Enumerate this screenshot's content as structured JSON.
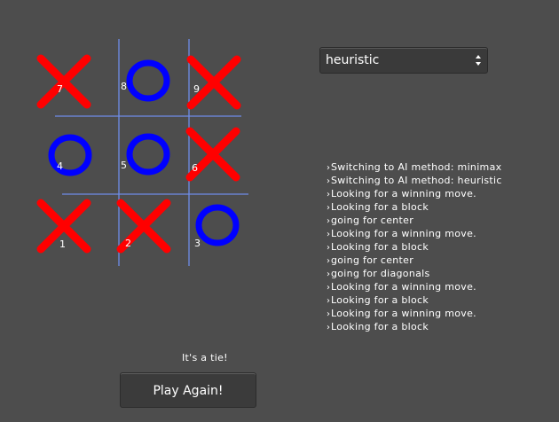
{
  "board": {
    "cells": [
      {
        "number": "7",
        "mark": "X"
      },
      {
        "number": "8",
        "mark": "O"
      },
      {
        "number": "9",
        "mark": "X"
      },
      {
        "number": "4",
        "mark": "O"
      },
      {
        "number": "5",
        "mark": "O"
      },
      {
        "number": "6",
        "mark": "X"
      },
      {
        "number": "1",
        "mark": "X"
      },
      {
        "number": "2",
        "mark": "X"
      },
      {
        "number": "3",
        "mark": "O"
      }
    ],
    "colors": {
      "x": "#ff0000",
      "o": "#0000ff",
      "grid": "#6f8ce8",
      "background": "#4d4d4d"
    }
  },
  "ai_method": {
    "selected": "heuristic",
    "icon": "up-down-arrows-icon"
  },
  "log": [
    "Switching to AI method: minimax",
    "Switching to AI method: heuristic",
    "Looking for a winning move.",
    "Looking for a block",
    "going for center",
    "Looking for a winning move.",
    "Looking for a block",
    "going for center",
    "going for diagonals",
    "Looking for a winning move.",
    "Looking for a block",
    "Looking for a winning move.",
    "Looking for a block"
  ],
  "status": "It's a tie!",
  "play_again_label": "Play Again!"
}
